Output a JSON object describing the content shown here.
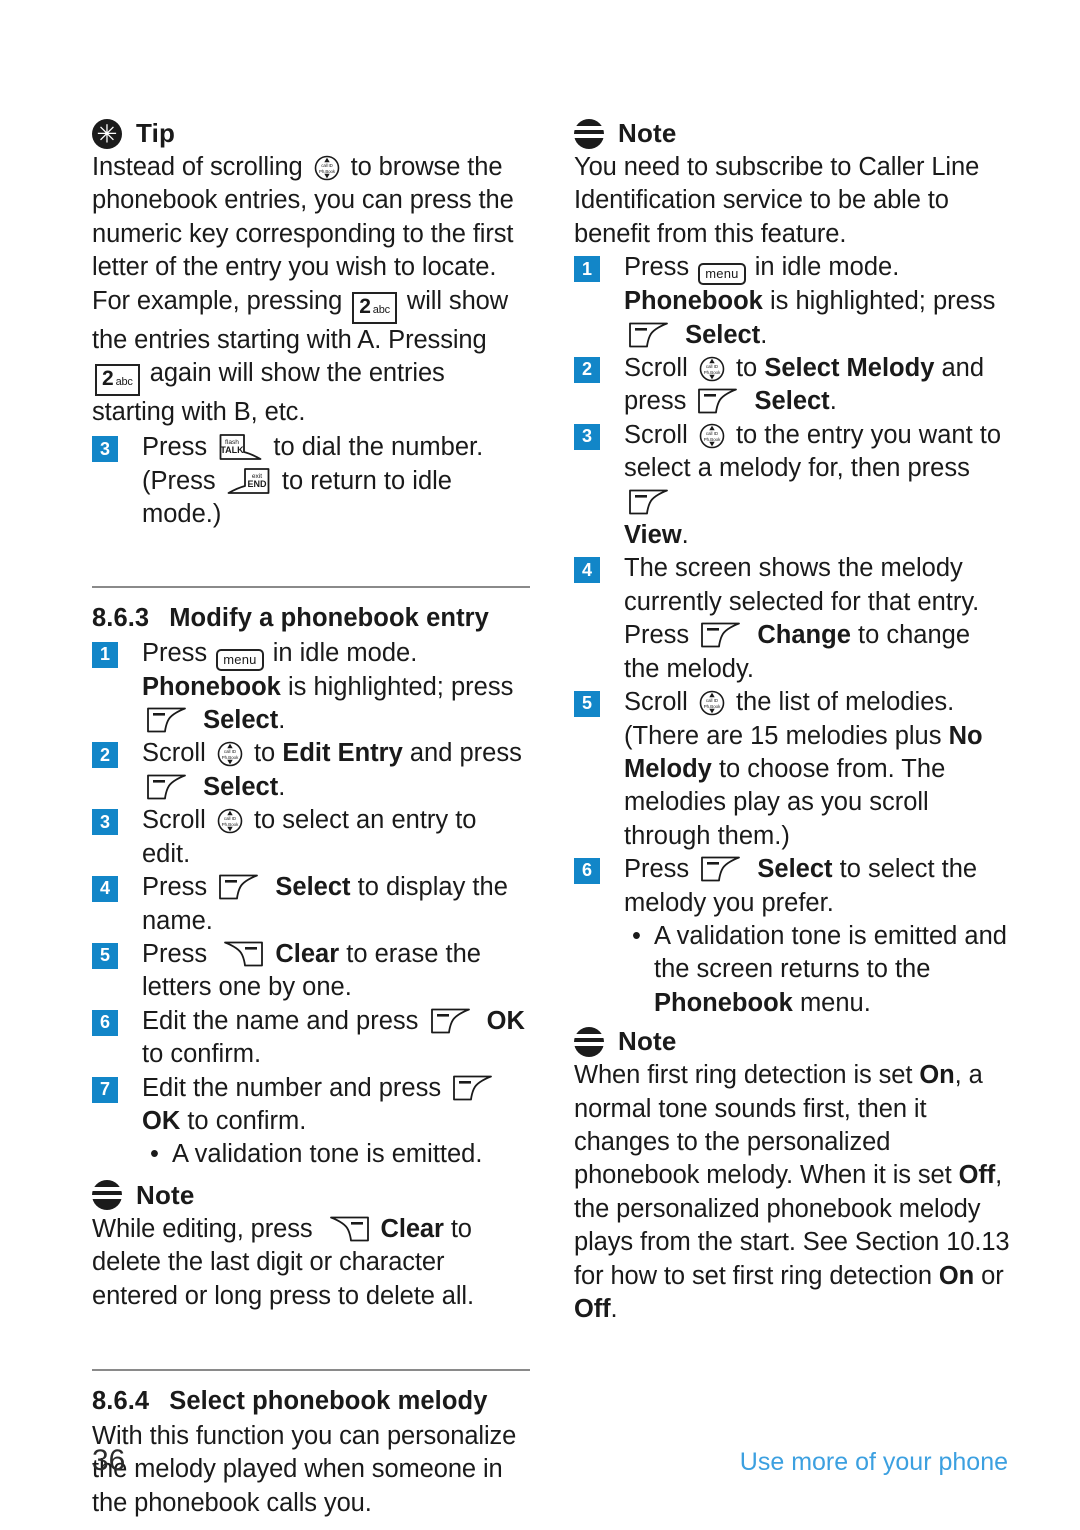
{
  "document": {
    "page_number": "36",
    "footer_label": "Use more of your phone",
    "accent_blue": "#1286c8",
    "footer_blue": "#3ca0e0"
  },
  "left_column": {
    "tip": {
      "title": "Tip",
      "icon": "asterisk-circle-icon",
      "body_before_key1": "Instead of scrolling",
      "body_mid1": "to browse the phonebook entries, you can press the numeric key corresponding to the first letter of the entry you wish to locate. For example, pressing",
      "key2_digit": "2",
      "key2_letters": "abc",
      "body_mid2": "will show the entries starting with A. Pressing",
      "body_mid3": "again will show the entries starting with B, etc.",
      "step": {
        "num": "3",
        "text_a": "Press",
        "text_b": "to dial the number. (Press",
        "text_c": "to return to idle mode.)"
      }
    },
    "section_863": {
      "number": "8.6.3",
      "title": "Modify a phonebook entry",
      "steps": [
        {
          "num": "1",
          "line1_a": "Press",
          "line1_b": "in idle mode.",
          "line2_bold": "Phonebook",
          "line2_rest": "is highlighted; press",
          "line3_bold": "Select",
          "line3_tail": "."
        },
        {
          "num": "2",
          "a": "Scroll",
          "b": "to",
          "b_bold": "Edit Entry",
          "c": "and press",
          "d_bold": "Select",
          "d_tail": "."
        },
        {
          "num": "3",
          "a": "Scroll",
          "b": "to select an entry to edit."
        },
        {
          "num": "4",
          "a": "Press",
          "b_bold": "Select",
          "c": "to display the name."
        },
        {
          "num": "5",
          "a": "Press",
          "b_bold": "Clear",
          "c": "to erase the letters one by one."
        },
        {
          "num": "6",
          "a": "Edit the name and press",
          "b_bold": "OK",
          "c": "to confirm."
        },
        {
          "num": "7",
          "a": "Edit the number and press",
          "b_bold": "OK",
          "c": "to confirm."
        }
      ],
      "bullet": "A validation tone is emitted."
    },
    "note": {
      "title": "Note",
      "icon": "striped-circle-icon",
      "a": "While editing, press",
      "b_bold": "Clear",
      "c": "to delete the last digit or character entered or long press to delete all."
    },
    "section_864": {
      "number": "8.6.4",
      "title": "Select phonebook melody",
      "body": "With this function you can personalize the melody played when someone in the phonebook calls you."
    }
  },
  "right_column": {
    "note_top": {
      "title": "Note",
      "icon": "striped-circle-icon",
      "body": "You need to subscribe to Caller Line Identification service to be able to benefit from this feature."
    },
    "steps": [
      {
        "num": "1",
        "line1_a": "Press",
        "line1_b": "in idle mode.",
        "line2_bold": "Phonebook",
        "line2_rest": "is highlighted; press",
        "line3_bold": "Select",
        "line3_tail": "."
      },
      {
        "num": "2",
        "a": "Scroll",
        "b": "to",
        "b_bold": "Select Melody",
        "c": "and press",
        "d_bold": "Select",
        "d_tail": "."
      },
      {
        "num": "3",
        "a": "Scroll",
        "b": "to the entry you want to select a melody for, then press",
        "c_bold": "View",
        "c_tail": "."
      },
      {
        "num": "4",
        "a": "The screen shows the melody currently selected for that entry. Press",
        "b_bold": "Change",
        "c": "to change the melody."
      },
      {
        "num": "5",
        "a": "Scroll",
        "b": "the list of melodies. (There are 15 melodies plus",
        "b_bold": "No Melody",
        "c": "to choose from. The melodies play as you scroll through them.)"
      },
      {
        "num": "6",
        "a": "Press",
        "b_bold": "Select",
        "c": "to select the melody you prefer."
      }
    ],
    "bullet": {
      "a": "A validation tone is emitted and the screen returns to the",
      "b_bold": "Phonebook",
      "c": "menu."
    },
    "note_bottom": {
      "title": "Note",
      "icon": "striped-circle-icon",
      "a": "When first ring detection is set",
      "on_1": "On",
      "b": ", a normal tone sounds first, then it changes to the personalized phonebook melody. When it is set",
      "off_1": "Off",
      "c": ", the personalized phonebook melody plays from the start. See Section 10.13 for how to set first ring detection",
      "on_2": "On",
      "d": "or",
      "off_2": "Off",
      "e": "."
    }
  },
  "icons": {
    "nav_key": "navigation-scroll-key-icon",
    "nav_key_top_label": "call ID",
    "nav_key_bottom_label": "Ph.Book",
    "menu_key": "menu-key-icon",
    "menu_key_label": "menu",
    "talk_key": "talk-key-icon",
    "talk_key_label_top": "flash",
    "talk_key_label_main": "TALK",
    "end_key": "end-key-icon",
    "end_key_label_top": "exit",
    "end_key_label_main": "END",
    "left_softkey": "left-soft-key-icon",
    "right_softkey": "right-soft-key-icon"
  }
}
